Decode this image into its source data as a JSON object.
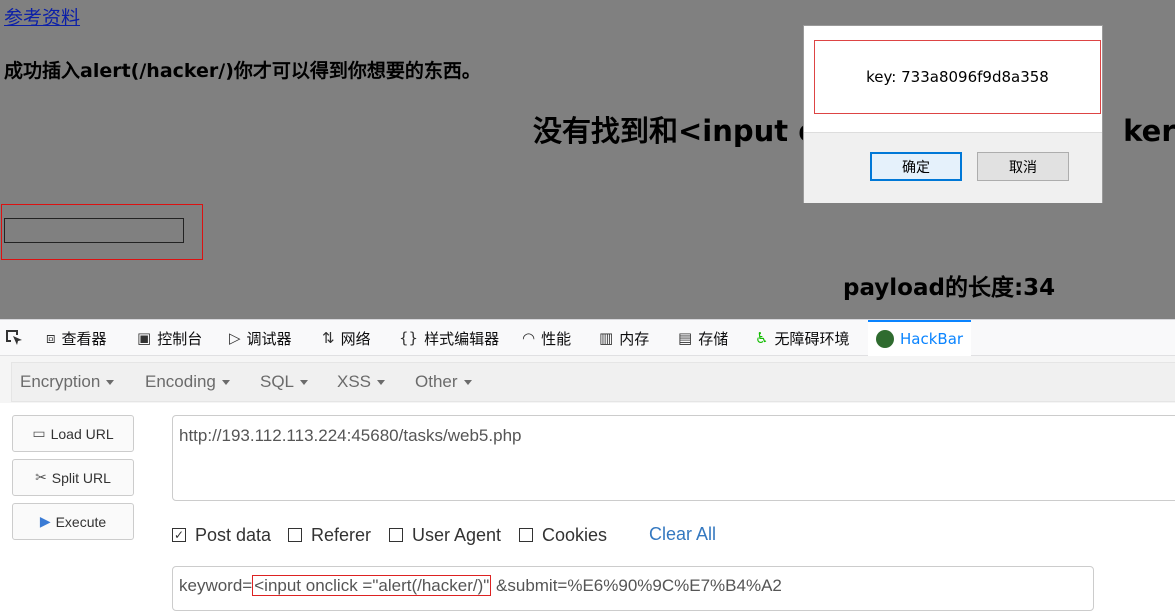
{
  "page": {
    "ref_link": "参考资料",
    "hint": "成功插入alert(/hacker/)你才可以得到你想要的东西。",
    "not_found": "没有找到和<input o",
    "not_found_tail": "ker/)'",
    "payload_length": "payload的长度:34"
  },
  "dialog": {
    "message": "key: 733a8096f9d8a358",
    "ok_label": "确定",
    "cancel_label": "取消"
  },
  "devtools": {
    "tabs": [
      {
        "label": "查看器",
        "icon": "inspector-icon"
      },
      {
        "label": "控制台",
        "icon": "console-icon"
      },
      {
        "label": "调试器",
        "icon": "debugger-icon"
      },
      {
        "label": "网络",
        "icon": "network-icon"
      },
      {
        "label": "样式编辑器",
        "icon": "style-editor-icon"
      },
      {
        "label": "性能",
        "icon": "performance-icon"
      },
      {
        "label": "内存",
        "icon": "memory-icon"
      },
      {
        "label": "存储",
        "icon": "storage-icon"
      },
      {
        "label": "无障碍环境",
        "icon": "accessibility-icon"
      },
      {
        "label": "HackBar",
        "icon": "hackbar-icon"
      }
    ],
    "active_tab": "HackBar"
  },
  "hackbar": {
    "menu": [
      "Encryption",
      "Encoding",
      "SQL",
      "XSS",
      "Other"
    ],
    "buttons": {
      "load": "Load URL",
      "split": "Split URL",
      "execute": "Execute"
    },
    "url": "http://193.112.113.224:45680/tasks/web5.php",
    "options": [
      {
        "label": "Post data",
        "checked": true
      },
      {
        "label": "Referer",
        "checked": false
      },
      {
        "label": "User Agent",
        "checked": false
      },
      {
        "label": "Cookies",
        "checked": false
      }
    ],
    "clear_all": "Clear All",
    "post_prefix": "keyword=",
    "post_highlight": "<input onclick =\"alert(/hacker/)\"",
    "post_suffix": " &submit=%E6%90%9C%E7%B4%A2"
  },
  "colors": {
    "accent": "#0a84ff",
    "highlight_border": "#dd2222",
    "link": "#3478c0"
  }
}
